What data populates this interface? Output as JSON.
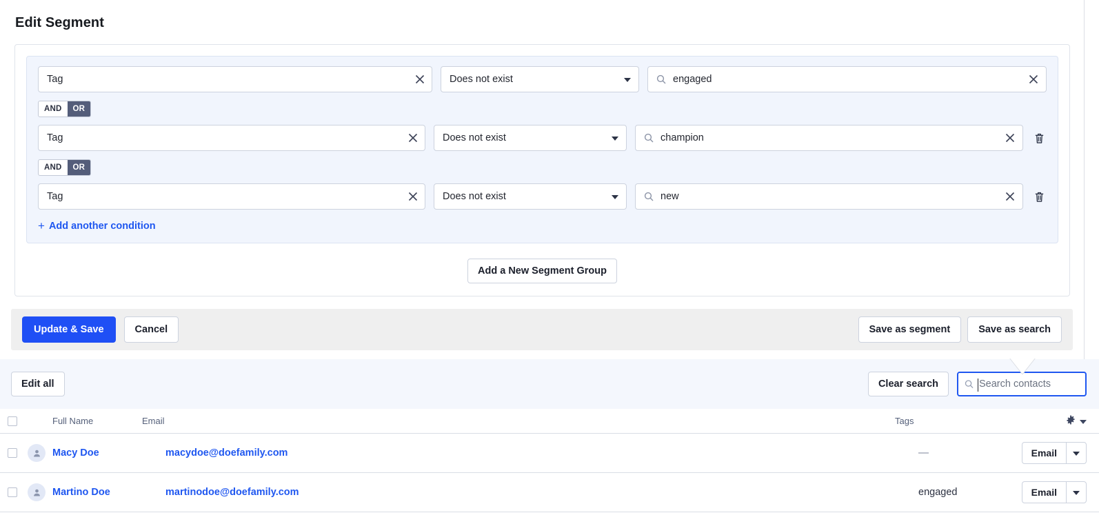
{
  "panel": {
    "title": "Edit Segment",
    "add_condition_label": "Add another condition",
    "add_condition_plus": "+",
    "add_group_label": "Add a New Segment Group",
    "conditions": [
      {
        "field": "Tag",
        "operator": "Does not exist",
        "value": "engaged",
        "logic_after": {
          "and": "AND",
          "or": "OR",
          "selected": "OR"
        },
        "has_delete": false
      },
      {
        "field": "Tag",
        "operator": "Does not exist",
        "value": "champion",
        "logic_after": {
          "and": "AND",
          "or": "OR",
          "selected": "OR"
        },
        "has_delete": true
      },
      {
        "field": "Tag",
        "operator": "Does not exist",
        "value": "new",
        "has_delete": true
      }
    ]
  },
  "actions": {
    "update_save": "Update & Save",
    "cancel": "Cancel",
    "save_as_segment": "Save as segment",
    "save_as_search": "Save as search"
  },
  "contacts_toolbar": {
    "edit_all": "Edit all",
    "clear_search": "Clear search",
    "search_placeholder": "Search contacts",
    "search_value": ""
  },
  "table": {
    "columns": [
      "Full Name",
      "Email",
      "Tags"
    ],
    "rows": [
      {
        "name": "Macy Doe",
        "email": "macydoe@doefamily.com",
        "tags": "—",
        "action": "Email"
      },
      {
        "name": "Martino Doe",
        "email": "martinodoe@doefamily.com",
        "tags": "engaged",
        "action": "Email"
      }
    ]
  },
  "colors": {
    "accent_blue": "#1f57f0",
    "primary_button": "#1f4ff5",
    "logic_active": "#545d7a",
    "group_bg": "#f1f5fd",
    "toolbar_bg": "#f4f7fd",
    "action_bar_bg": "#efefef"
  }
}
